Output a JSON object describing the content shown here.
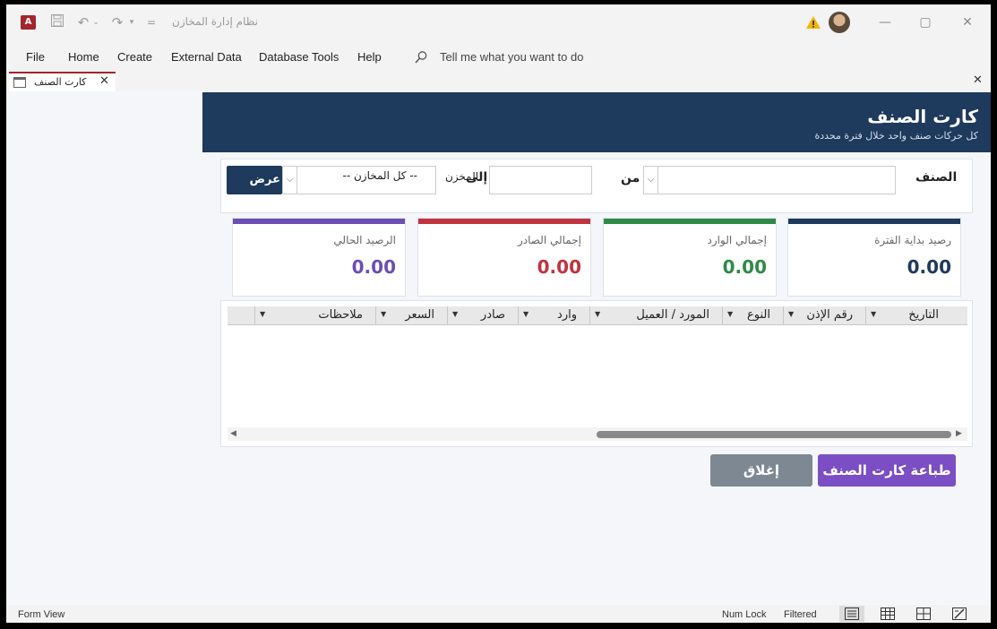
{
  "window": {
    "app_title": "نظام إدارة المخازن",
    "app_logo_letter": "A"
  },
  "menu": {
    "items": [
      "File",
      "Home",
      "Create",
      "External Data",
      "Database Tools",
      "Help"
    ],
    "tell_me": "Tell me what you want to do"
  },
  "doc_tab": {
    "label": "كارت الصنف"
  },
  "form": {
    "title": "كارت الصنف",
    "subtitle": "كل حركات صنف واحد خلال فترة محددة",
    "filters": {
      "item_label": "الصنف",
      "from_label": "من",
      "to_label": "إلى",
      "store_label": "المخزن",
      "store_value": "-- كل المخازن --",
      "show_button": "عرض"
    },
    "cards": [
      {
        "label": "رصيد بداية الفترة",
        "value": "0.00",
        "color": "#1e3a5c"
      },
      {
        "label": "إجمالي الوارد",
        "value": "0.00",
        "color": "#2e8b47"
      },
      {
        "label": "إجمالي الصادر",
        "value": "0.00",
        "color": "#c0333f"
      },
      {
        "label": "الرصيد الحالي",
        "value": "0.00",
        "color": "#6b4fb3"
      }
    ],
    "grid_columns": [
      "التاريخ",
      "رقم الإذن",
      "النوع",
      "المورد / العميل",
      "وارد",
      "صادر",
      "السعر",
      "ملاحظات"
    ],
    "buttons": {
      "close": "إغلاق",
      "print": "طباعة كارت الصنف"
    }
  },
  "status": {
    "view": "Form View",
    "num_lock": "Num Lock",
    "filtered": "Filtered"
  },
  "colors": {
    "header": "#1e3a5c",
    "accent_purple": "#7b4ec4",
    "close_gray": "#7d8893",
    "access_red": "#a4262c"
  }
}
